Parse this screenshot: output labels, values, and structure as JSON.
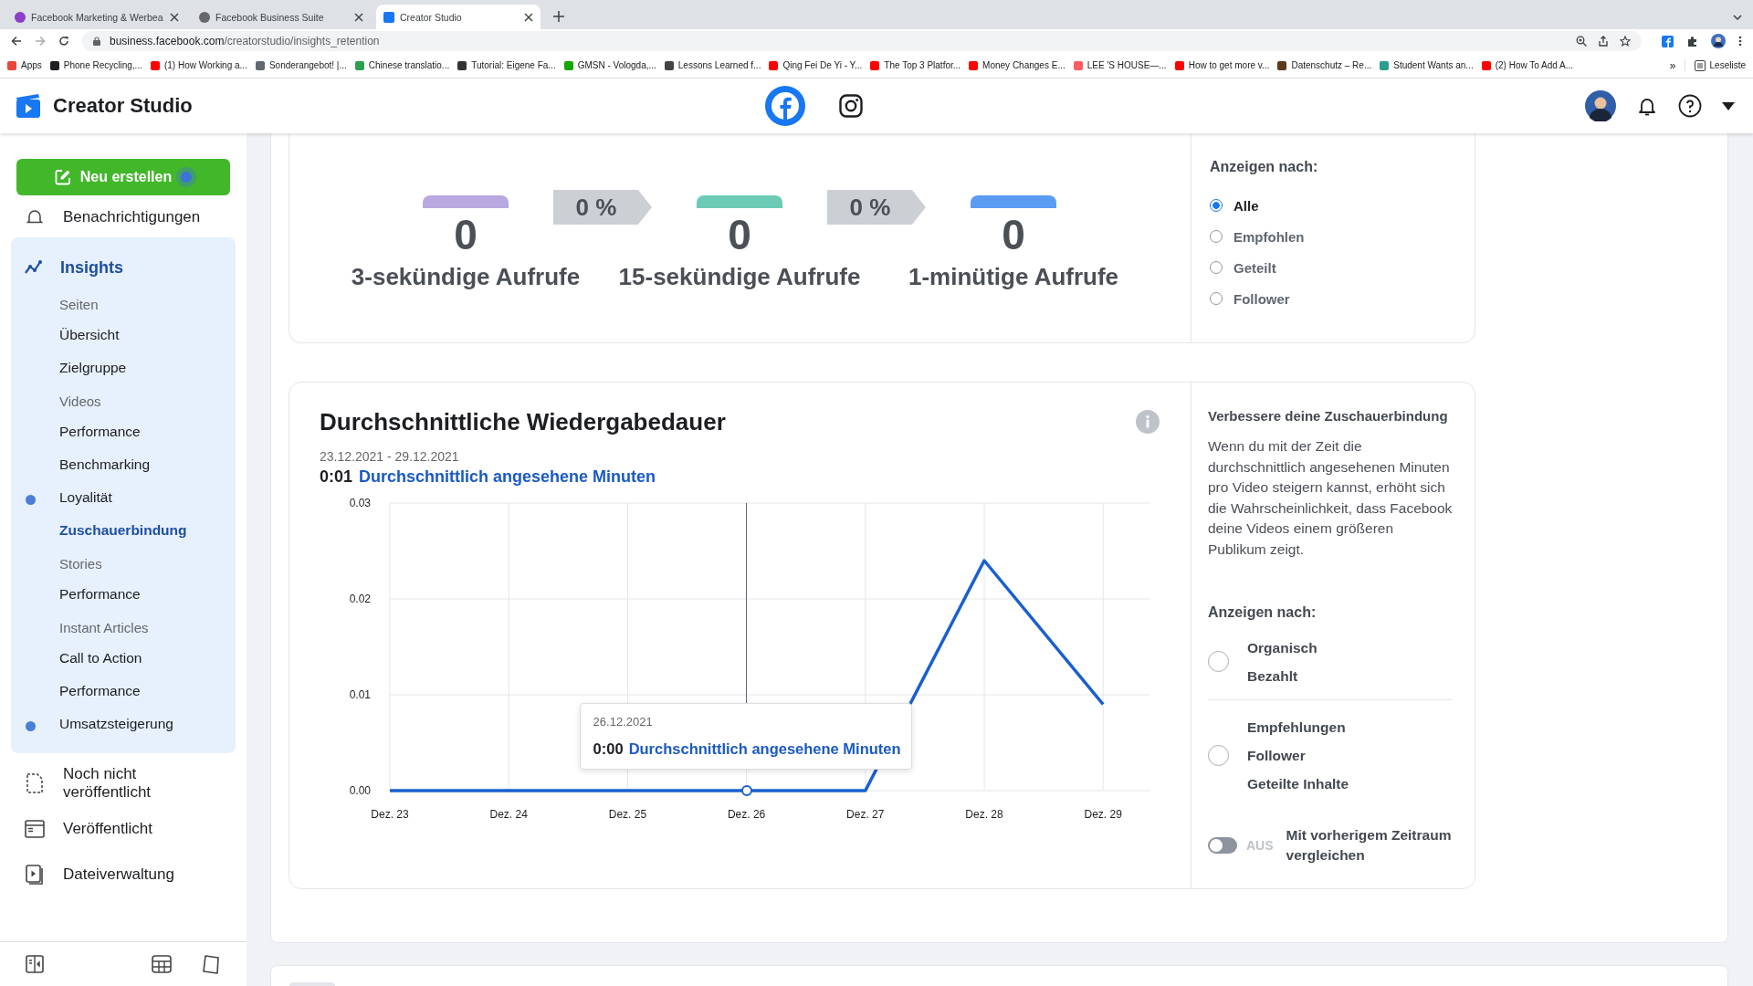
{
  "browser": {
    "tabs": [
      {
        "title": "Facebook Marketing & Werbea",
        "selected": false,
        "color": "#8e3ec8"
      },
      {
        "title": "Facebook Business Suite",
        "selected": false,
        "color": "#65676b"
      },
      {
        "title": "Creator Studio",
        "selected": true,
        "color": "#1877f2"
      }
    ],
    "url_host": "business.facebook.com",
    "url_path": "/creatorstudio/insights_retention",
    "bookmarks": [
      {
        "label": "Apps",
        "color": "#e8453c"
      },
      {
        "label": "Phone Recycling,...",
        "color": "#1c1e21"
      },
      {
        "label": "(1) How Working a...",
        "color": "#ff0000"
      },
      {
        "label": "Sonderangebot! |...",
        "color": "#606770"
      },
      {
        "label": "Chinese translatio...",
        "color": "#2e9e4f"
      },
      {
        "label": "Tutorial: Eigene Fa...",
        "color": "#333333"
      },
      {
        "label": "GMSN - Vologda,...",
        "color": "#14a800"
      },
      {
        "label": "Lessons Learned f...",
        "color": "#444444"
      },
      {
        "label": "Qing Fei De Yi - Y...",
        "color": "#ff0000"
      },
      {
        "label": "The Top 3 Platfor...",
        "color": "#ff0000"
      },
      {
        "label": "Money Changes E...",
        "color": "#ff0000"
      },
      {
        "label": "LEE 'S HOUSE—...",
        "color": "#ff5a5f"
      },
      {
        "label": "How to get more v...",
        "color": "#ff0000"
      },
      {
        "label": "Datenschutz – Re...",
        "color": "#5b3a1e"
      },
      {
        "label": "Student Wants an...",
        "color": "#2a9d8f"
      },
      {
        "label": "(2) How To Add A...",
        "color": "#ff0000"
      }
    ],
    "more": "»",
    "reading_list": "Leseliste"
  },
  "app_header": {
    "title": "Creator Studio",
    "platforms": [
      {
        "kind": "facebook",
        "selected": true
      },
      {
        "kind": "instagram",
        "selected": false
      }
    ]
  },
  "sidebar": {
    "create_button": {
      "label": "Neu erstellen",
      "dot": true
    },
    "partial_item": "Benachrichtigungen",
    "insights": {
      "label": "Insights",
      "expanded": true,
      "groups": [
        {
          "heading": "Seiten",
          "items": [
            {
              "label": "Übersicht",
              "selected": false,
              "dot": false
            },
            {
              "label": "Zielgruppe",
              "selected": false,
              "dot": false
            }
          ]
        },
        {
          "heading": "Videos",
          "items": [
            {
              "label": "Performance",
              "selected": false,
              "dot": false
            },
            {
              "label": "Benchmarking",
              "selected": false,
              "dot": false
            },
            {
              "label": "Loyalität",
              "selected": false,
              "dot": true
            },
            {
              "label": "Zuschauerbindung",
              "selected": true,
              "dot": false
            }
          ]
        },
        {
          "heading": "Stories",
          "items": [
            {
              "label": "Performance",
              "selected": false,
              "dot": false
            }
          ]
        },
        {
          "heading": "Instant Articles",
          "items": [
            {
              "label": "Call to Action",
              "selected": false,
              "dot": false
            },
            {
              "label": "Performance",
              "selected": false,
              "dot": false
            },
            {
              "label": "Umsatzsteigerung",
              "selected": false,
              "dot": true
            }
          ]
        }
      ]
    },
    "items": [
      {
        "label": "Noch nicht veröffentlicht",
        "kind": "document"
      },
      {
        "label": "Veröffentlicht",
        "kind": "window"
      },
      {
        "label": "Dateiverwaltung",
        "kind": "video-file"
      }
    ]
  },
  "retention_card": {
    "stages": [
      {
        "value": "0",
        "label": "3-sekündige Aufrufe",
        "color": "#b9a9e0"
      },
      {
        "value": "0",
        "label": "15-sekündige Aufrufe",
        "color": "#6ccbb5"
      },
      {
        "value": "0",
        "label": "1-minütige Aufrufe",
        "color": "#5b9cf2"
      }
    ],
    "rates": [
      "0 %",
      "0 %"
    ],
    "filter": {
      "heading": "Anzeigen nach:",
      "options": [
        {
          "label": "Alle",
          "selected": true
        },
        {
          "label": "Empfohlen",
          "selected": false
        },
        {
          "label": "Geteilt",
          "selected": false
        },
        {
          "label": "Follower",
          "selected": false
        }
      ]
    }
  },
  "duration_card": {
    "title": "Durchschnittliche Wiedergabedauer",
    "date_range": "23.12.2021 - 29.12.2021",
    "summary_value": "0:01",
    "chart_data": {
      "type": "line",
      "categories": [
        "Dez. 23",
        "Dez. 24",
        "Dez. 25",
        "Dez. 26",
        "Dez. 27",
        "Dez. 28",
        "Dez. 29"
      ],
      "series": [
        {
          "name": "Durchschnittlich angesehene Minuten",
          "color": "#1a5fd0",
          "values": [
            0,
            0,
            0,
            0,
            0,
            0.024,
            0.009
          ]
        }
      ],
      "ylim": [
        0,
        0.03
      ],
      "yticks": [
        {
          "value": 0,
          "label": "0.00"
        },
        {
          "value": 0.01,
          "label": "0.01"
        },
        {
          "value": 0.02,
          "label": "0.02"
        },
        {
          "value": 0.03,
          "label": "0.03"
        }
      ],
      "grid": true
    },
    "tooltip": {
      "points": [
        {
          "selected": false
        },
        {
          "selected": false
        },
        {
          "selected": false
        },
        {
          "selected": true
        },
        {
          "selected": false
        },
        {
          "selected": false
        },
        {
          "selected": false
        }
      ],
      "date": "26.12.2021",
      "value": "0:00",
      "label": "Durchschnittlich angesehene Minuten"
    },
    "side": {
      "heading": "Verbessere deine Zuschauerbindung",
      "text": "Wenn du mit der Zeit die durchschnittlich angesehenen Minuten pro Video steigern kannst, erhöht sich die Wahrscheinlichkeit, dass Facebook deine Videos einem größeren Publikum zeigt.",
      "filter_heading": "Anzeigen nach:",
      "option_groups": [
        {
          "selected": false,
          "labels": [
            "Organisch",
            "Bezahlt"
          ]
        },
        {
          "selected": false,
          "labels": [
            "Empfehlungen",
            "Follower",
            "Geteilte Inhalte"
          ]
        }
      ],
      "compare_toggle": {
        "on": false,
        "state_label": "AUS",
        "label": "Mit vorherigem Zeitraum vergleichen"
      }
    }
  }
}
